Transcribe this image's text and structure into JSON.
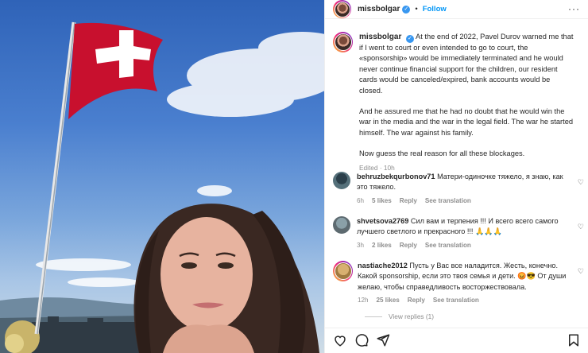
{
  "post": {
    "username": "missbolgar",
    "follow_label": "Follow",
    "dot": "•",
    "more": "···",
    "caption_username": "missbolgar",
    "caption_paragraphs": [
      "At the end of 2022, Pavel Durov warned me that if I went to court or even intended to go to court, the «sponsorship» would be immediately terminated and he would never continue financial support for the children, our resident cards would be canceled/expired, bank accounts would be closed.",
      "And he assured me that he had no doubt that he would win the war in the media and the war in the legal field. The war he started himself. The war against his family.",
      "Now guess the real reason for all these blockages."
    ],
    "edited": "Edited · 10h"
  },
  "comments": [
    {
      "username": "behruzbekqurbonov71",
      "text": "Матери-одиночке тяжело, я знаю, как это тяжело.",
      "time": "6h",
      "likes": "5 likes",
      "reply": "Reply",
      "translate": "See translation"
    },
    {
      "username": "shvetsova2769",
      "text": "Сил вам и терпения !!! И всего всего самого лучшего светлого и прекрасного !!! 🙏🙏🙏",
      "time": "3h",
      "likes": "2 likes",
      "reply": "Reply",
      "translate": "See translation"
    },
    {
      "username": "nastiache2012",
      "text": "Пусть у Вас все наладится. Жесть, конечно. Какой sponsorship, если это твоя семья и дети. 😡😎 От души желаю, чтобы справедливость восторжествовала.",
      "time": "12h",
      "likes": "25 likes",
      "reply": "Reply",
      "translate": "See translation"
    }
  ],
  "view_replies": "View replies (1)",
  "icons": [
    "heart-icon",
    "comment-icon",
    "share-icon",
    "bookmark-icon",
    "more-icon",
    "verified-icon"
  ],
  "colors": {
    "accent": "#0095f6",
    "verified": "#3897f0",
    "flag_red": "#c8102e",
    "muted": "#8e8e8e"
  }
}
